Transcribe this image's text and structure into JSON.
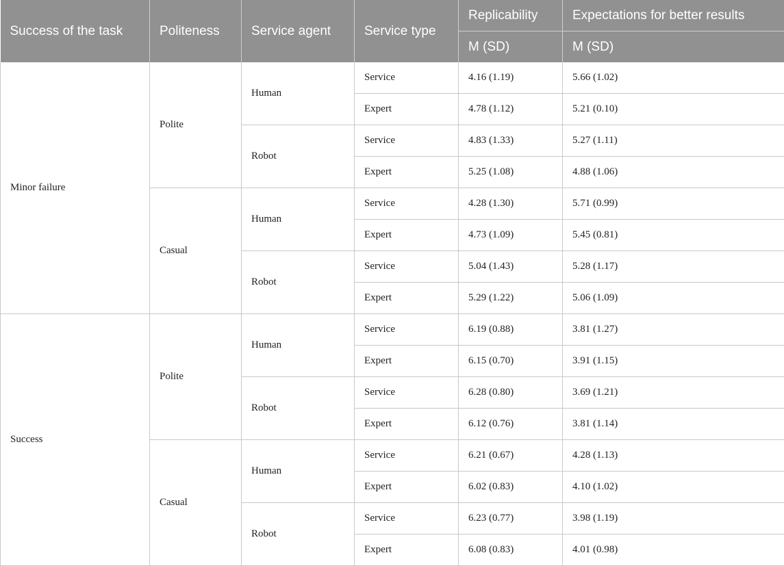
{
  "headers": {
    "success": "Success of the task",
    "politeness": "Politeness",
    "agent": "Service agent",
    "type": "Service type",
    "replicability": "Replicability",
    "expectations": "Expectations for better results",
    "rep_sub": "M (SD)",
    "exp_sub": "M (SD)"
  },
  "groups": [
    {
      "success": "Minor failure",
      "politeness": [
        {
          "label": "Polite",
          "agents": [
            {
              "label": "Human",
              "rows": [
                {
                  "type": "Service",
                  "rep": "4.16 (1.19)",
                  "exp": "5.66 (1.02)"
                },
                {
                  "type": "Expert",
                  "rep": "4.78 (1.12)",
                  "exp": "5.21 (0.10)"
                }
              ]
            },
            {
              "label": "Robot",
              "rows": [
                {
                  "type": "Service",
                  "rep": "4.83 (1.33)",
                  "exp": "5.27 (1.11)"
                },
                {
                  "type": "Expert",
                  "rep": "5.25 (1.08)",
                  "exp": "4.88 (1.06)"
                }
              ]
            }
          ]
        },
        {
          "label": "Casual",
          "agents": [
            {
              "label": "Human",
              "rows": [
                {
                  "type": "Service",
                  "rep": "4.28 (1.30)",
                  "exp": "5.71 (0.99)"
                },
                {
                  "type": "Expert",
                  "rep": "4.73 (1.09)",
                  "exp": "5.45 (0.81)"
                }
              ]
            },
            {
              "label": "Robot",
              "rows": [
                {
                  "type": "Service",
                  "rep": "5.04 (1.43)",
                  "exp": "5.28 (1.17)"
                },
                {
                  "type": "Expert",
                  "rep": "5.29 (1.22)",
                  "exp": "5.06 (1.09)"
                }
              ]
            }
          ]
        }
      ]
    },
    {
      "success": "Success",
      "politeness": [
        {
          "label": "Polite",
          "agents": [
            {
              "label": "Human",
              "rows": [
                {
                  "type": "Service",
                  "rep": "6.19 (0.88)",
                  "exp": "3.81 (1.27)"
                },
                {
                  "type": "Expert",
                  "rep": "6.15 (0.70)",
                  "exp": "3.91 (1.15)"
                }
              ]
            },
            {
              "label": "Robot",
              "rows": [
                {
                  "type": "Service",
                  "rep": "6.28 (0.80)",
                  "exp": "3.69 (1.21)"
                },
                {
                  "type": "Expert",
                  "rep": "6.12 (0.76)",
                  "exp": "3.81 (1.14)"
                }
              ]
            }
          ]
        },
        {
          "label": "Casual",
          "agents": [
            {
              "label": "Human",
              "rows": [
                {
                  "type": "Service",
                  "rep": "6.21 (0.67)",
                  "exp": "4.28 (1.13)"
                },
                {
                  "type": "Expert",
                  "rep": "6.02 (0.83)",
                  "exp": "4.10 (1.02)"
                }
              ]
            },
            {
              "label": "Robot",
              "rows": [
                {
                  "type": "Service",
                  "rep": "6.23 (0.77)",
                  "exp": "3.98 (1.19)"
                },
                {
                  "type": "Expert",
                  "rep": "6.08 (0.83)",
                  "exp": "4.01 (0.98)"
                }
              ]
            }
          ]
        }
      ]
    }
  ]
}
